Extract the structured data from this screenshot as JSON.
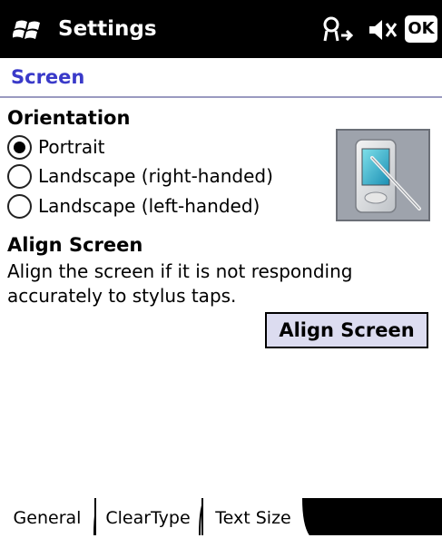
{
  "titlebar": {
    "title": "Settings",
    "ok_label": "OK",
    "icons": [
      "windows-flag-icon",
      "connectivity-icon",
      "volume-muted-icon"
    ]
  },
  "page": {
    "title": "Screen"
  },
  "orientation": {
    "heading": "Orientation",
    "options": [
      {
        "label": "Portrait",
        "selected": true
      },
      {
        "label": "Landscape (right-handed)",
        "selected": false
      },
      {
        "label": "Landscape (left-handed)",
        "selected": false
      }
    ]
  },
  "align": {
    "heading": "Align Screen",
    "description": "Align the screen if it is not responding accurately to stylus taps.",
    "button_label": "Align Screen"
  },
  "tabs": [
    {
      "label": "General",
      "active": true
    },
    {
      "label": "ClearType",
      "active": false
    },
    {
      "label": "Text Size",
      "active": false
    }
  ],
  "colors": {
    "titlebar_bg": "#000000",
    "page_title": "#3a3ac9",
    "button_bg": "#dcdcf0",
    "device_panel_bg": "#9ea3ac"
  }
}
